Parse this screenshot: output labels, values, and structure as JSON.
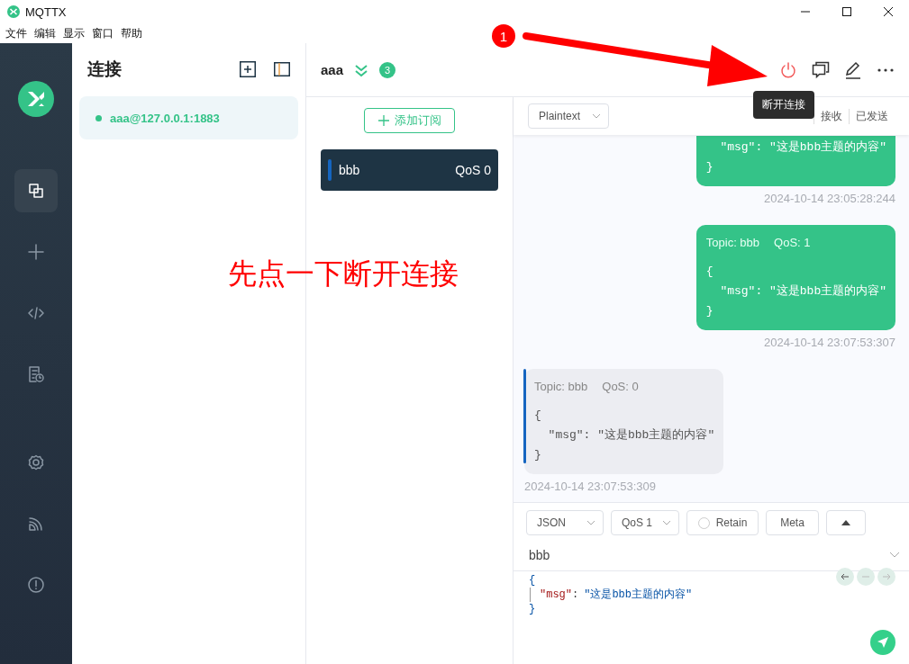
{
  "window": {
    "title": "MQTTX"
  },
  "menu": [
    "文件",
    "编辑",
    "显示",
    "窗口",
    "帮助"
  ],
  "nav": [
    {
      "kind": "connections",
      "selected": true
    },
    {
      "kind": "new",
      "selected": false
    },
    {
      "kind": "script",
      "selected": false
    },
    {
      "kind": "log",
      "selected": false
    },
    {
      "kind": "settings",
      "selected": false
    },
    {
      "kind": "feed",
      "selected": false
    },
    {
      "kind": "about",
      "selected": false
    }
  ],
  "connections": {
    "title": "连接",
    "items": [
      {
        "name": "aaa@127.0.0.1:1883",
        "connected": true,
        "selected": true
      }
    ]
  },
  "header": {
    "name": "aaa",
    "unread": "3",
    "tooltip": "断开连接"
  },
  "subscriptions": {
    "add_label": "添加订阅",
    "items": [
      {
        "topic": "bbb",
        "qos": "QoS 0",
        "color": "#1565c0"
      }
    ]
  },
  "format": "Plaintext",
  "filters": [
    {
      "label": "接收"
    },
    {
      "label": "已发送"
    }
  ],
  "messages": [
    {
      "kind": "sent",
      "lines": [
        "  \"msg\": \"这是bbb主题的内容\"",
        "}"
      ],
      "time": "2024-10-14 23:05:28:244"
    },
    {
      "kind": "sent",
      "topic": "Topic: bbb",
      "qos": "QoS: 1",
      "lines": [
        "{",
        "  \"msg\": \"这是bbb主题的内容\"",
        "}"
      ],
      "time": "2024-10-14 23:07:53:307"
    },
    {
      "kind": "received",
      "color": "#1565c0",
      "topic": "Topic: bbb",
      "qos": "QoS: 0",
      "lines": [
        "{",
        "  \"msg\": \"这是bbb主题的内容\"",
        "}"
      ],
      "time": "2024-10-14 23:07:53:309"
    }
  ],
  "publish": {
    "format": "JSON",
    "qos": "QoS 1",
    "retain": false,
    "retain_label": "Retain",
    "meta": "Meta",
    "topic": "bbb",
    "payload": {
      "open": "{",
      "entries": [
        {
          "key": "\"msg\"",
          "sep": ":",
          "value": "\"这是bbb主题的内容\""
        }
      ],
      "close": "}"
    }
  },
  "annotation": {
    "badge": "1",
    "text": "先点一下断开连接"
  }
}
